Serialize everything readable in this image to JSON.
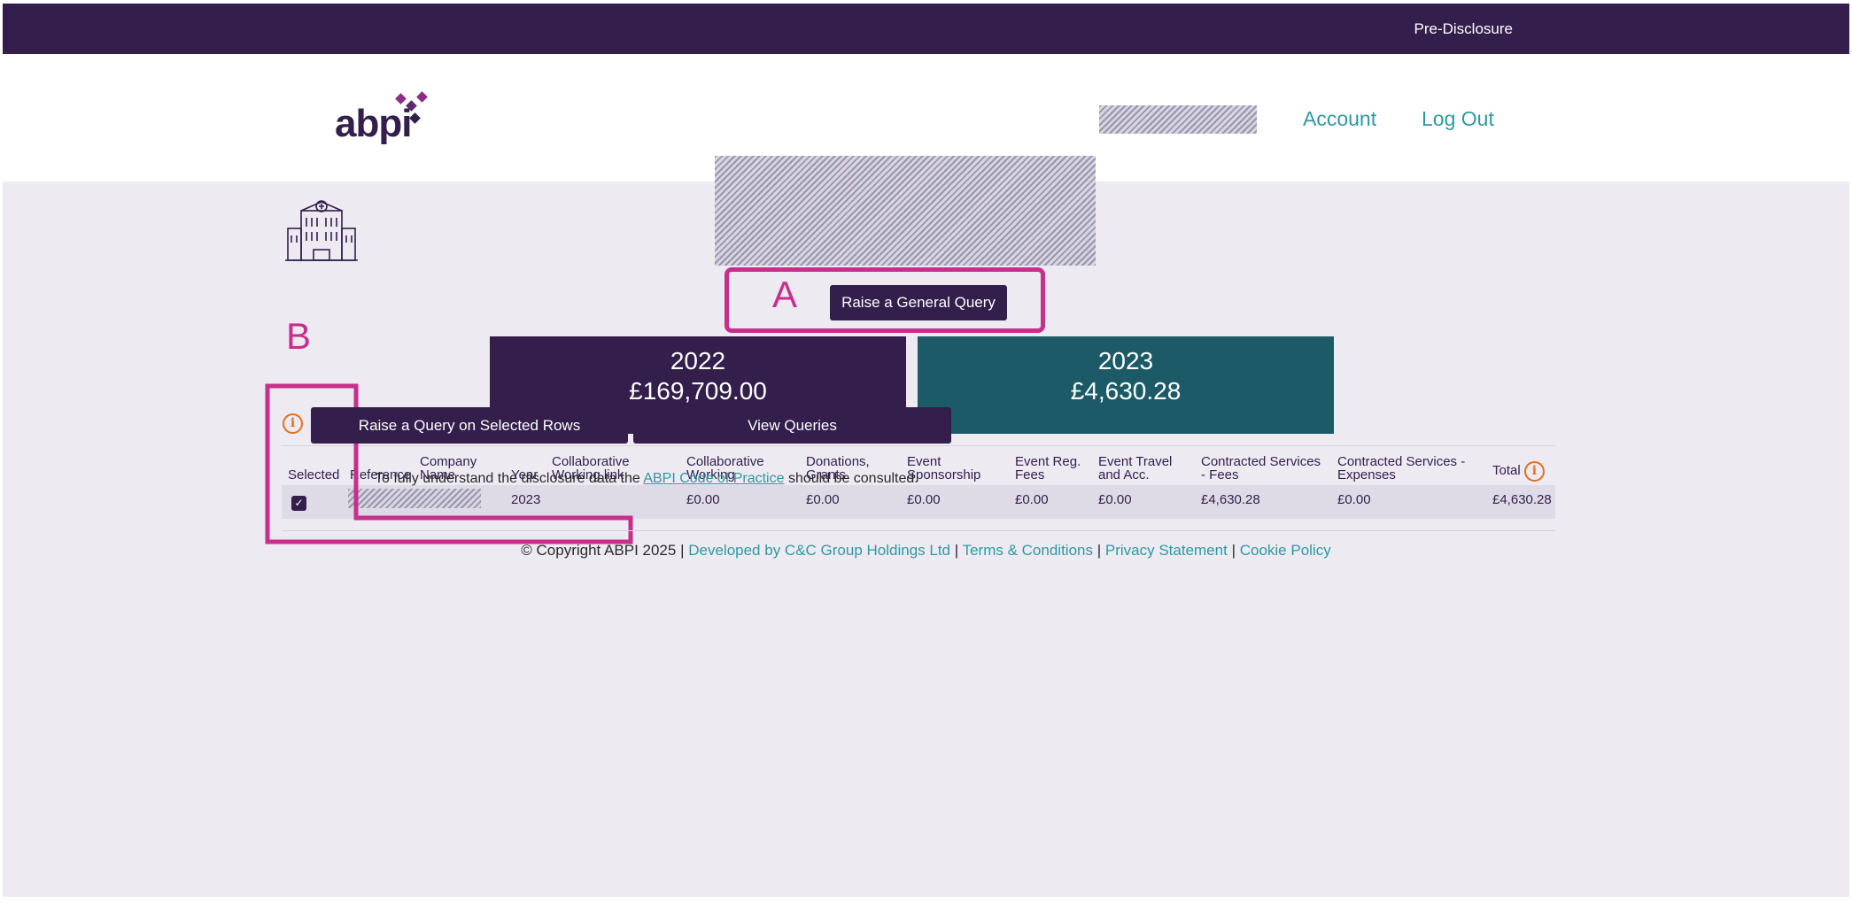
{
  "topbar": {
    "pre_disclosure": "Pre-Disclosure"
  },
  "header": {
    "logo_text": "abpi",
    "nav": {
      "account": "Account",
      "logout": "Log Out"
    }
  },
  "annotations": {
    "a": "A",
    "b": "B"
  },
  "general_query_button": "Raise a General Query",
  "years": [
    {
      "year": "2022",
      "total": "£169,709.00",
      "color": "#331e4c"
    },
    {
      "year": "2023",
      "total": "£4,630.28",
      "color": "#1c5a68"
    }
  ],
  "table": {
    "headers": {
      "selected": "Selected",
      "reference": "Reference",
      "company_name_1": "Company",
      "company_name_2": "Name",
      "year": "Year",
      "collab_link_1": "Collaborative",
      "collab_link_2": "Working link",
      "collab_working_1": "Collaborative",
      "collab_working_2": "Working",
      "donations_1": "Donations,",
      "donations_2": "Grants",
      "event_spons_1": "Event",
      "event_spons_2": "Sponsorship",
      "event_reg_1": "Event Reg.",
      "event_reg_2": "Fees",
      "event_travel_1": "Event Travel",
      "event_travel_2": "and Acc.",
      "cs_fees_1": "Contracted Services",
      "cs_fees_2": "- Fees",
      "cs_exp_1": "Contracted Services -",
      "cs_exp_2": "Expenses",
      "total": "Total"
    },
    "row": {
      "year": "2023",
      "collab_working": "£0.00",
      "donations": "£0.00",
      "event_sponsorship": "£0.00",
      "event_reg_fees": "£0.00",
      "event_travel": "£0.00",
      "cs_fees": "£4,630.28",
      "cs_expenses": "£0.00",
      "total": "£4,630.28"
    }
  },
  "buttons": {
    "raise_selected": "Raise a Query on Selected Rows",
    "view_queries": "View Queries"
  },
  "note": {
    "before": "To fully understand the disclosure data the ",
    "link": "ABPI Code of Practice",
    "after": " should be consulted."
  },
  "footer": {
    "copyright": "© Copyright ABPI 2025",
    "sep": "|",
    "developed": "Developed by C&C Group Holdings Ltd",
    "terms": "Terms & Conditions",
    "privacy": "Privacy Statement",
    "cookie": "Cookie Policy"
  }
}
